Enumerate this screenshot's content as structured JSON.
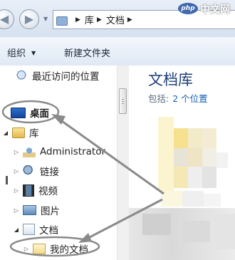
{
  "watermark": {
    "logo": "php",
    "text": "中文网"
  },
  "address_bar": {
    "crumbs": [
      "库",
      "文档"
    ]
  },
  "command_bar": {
    "organize": "组织",
    "new_folder": "新建文件夹"
  },
  "nav_pane": {
    "recent": "最近访问的位置",
    "desktop": "桌面",
    "library": "库",
    "administrator": "Administrator",
    "links": "链接",
    "videos": "视频",
    "pictures": "图片",
    "documents": "文档",
    "my_documents": "我的文档"
  },
  "content": {
    "title": "文档库",
    "includes_label": "包括:",
    "includes_link": "2 个位置"
  },
  "colors": {
    "annotation": "#8a8a8a",
    "title": "#1e3e78",
    "link": "#1a5fb4"
  }
}
